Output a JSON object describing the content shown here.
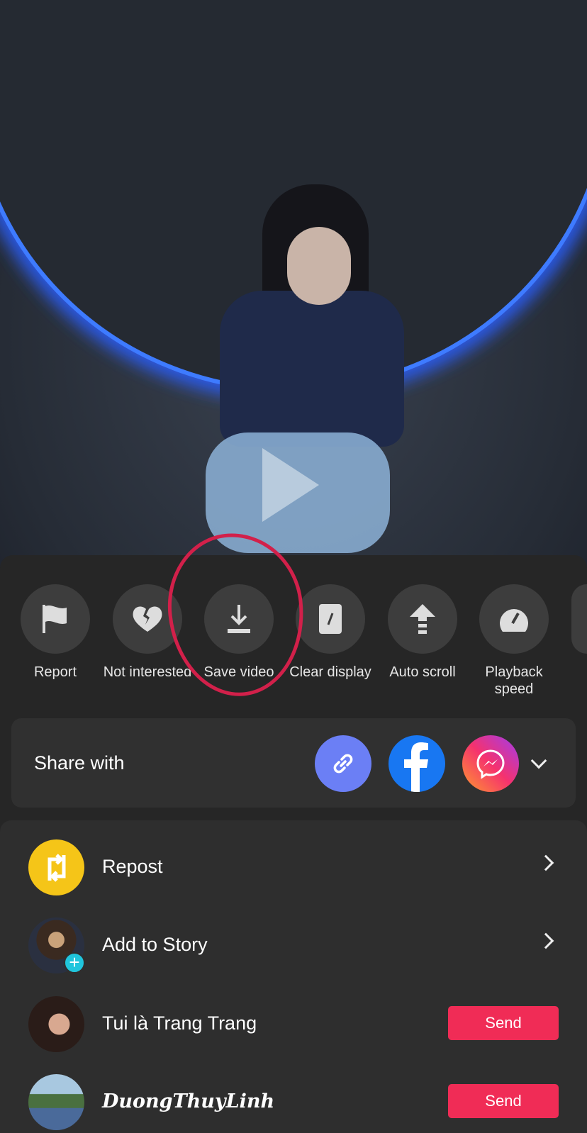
{
  "video": {
    "play_icon": "play-icon"
  },
  "actions": [
    {
      "label": "Report",
      "icon": "flag-icon"
    },
    {
      "label": "Not interested",
      "icon": "broken-heart-icon"
    },
    {
      "label": "Save video",
      "icon": "download-icon"
    },
    {
      "label": "Clear display",
      "icon": "clear-display-icon"
    },
    {
      "label": "Auto scroll",
      "icon": "auto-scroll-icon"
    },
    {
      "label": "Playback speed",
      "icon": "speedometer-icon"
    }
  ],
  "share": {
    "title": "Share with",
    "targets": [
      "copy-link",
      "facebook",
      "messenger"
    ]
  },
  "list": [
    {
      "label": "Repost"
    },
    {
      "label": "Add to Story"
    },
    {
      "label": "Tui là Trang Trang",
      "button": "Send"
    },
    {
      "label": "DuongThuyLinh",
      "button": "Send"
    }
  ],
  "colors": {
    "send": "#f02c56",
    "repost": "#f5c518",
    "link": "#6b7ff5",
    "facebook": "#1877f2",
    "annotation": "#d2204a"
  }
}
